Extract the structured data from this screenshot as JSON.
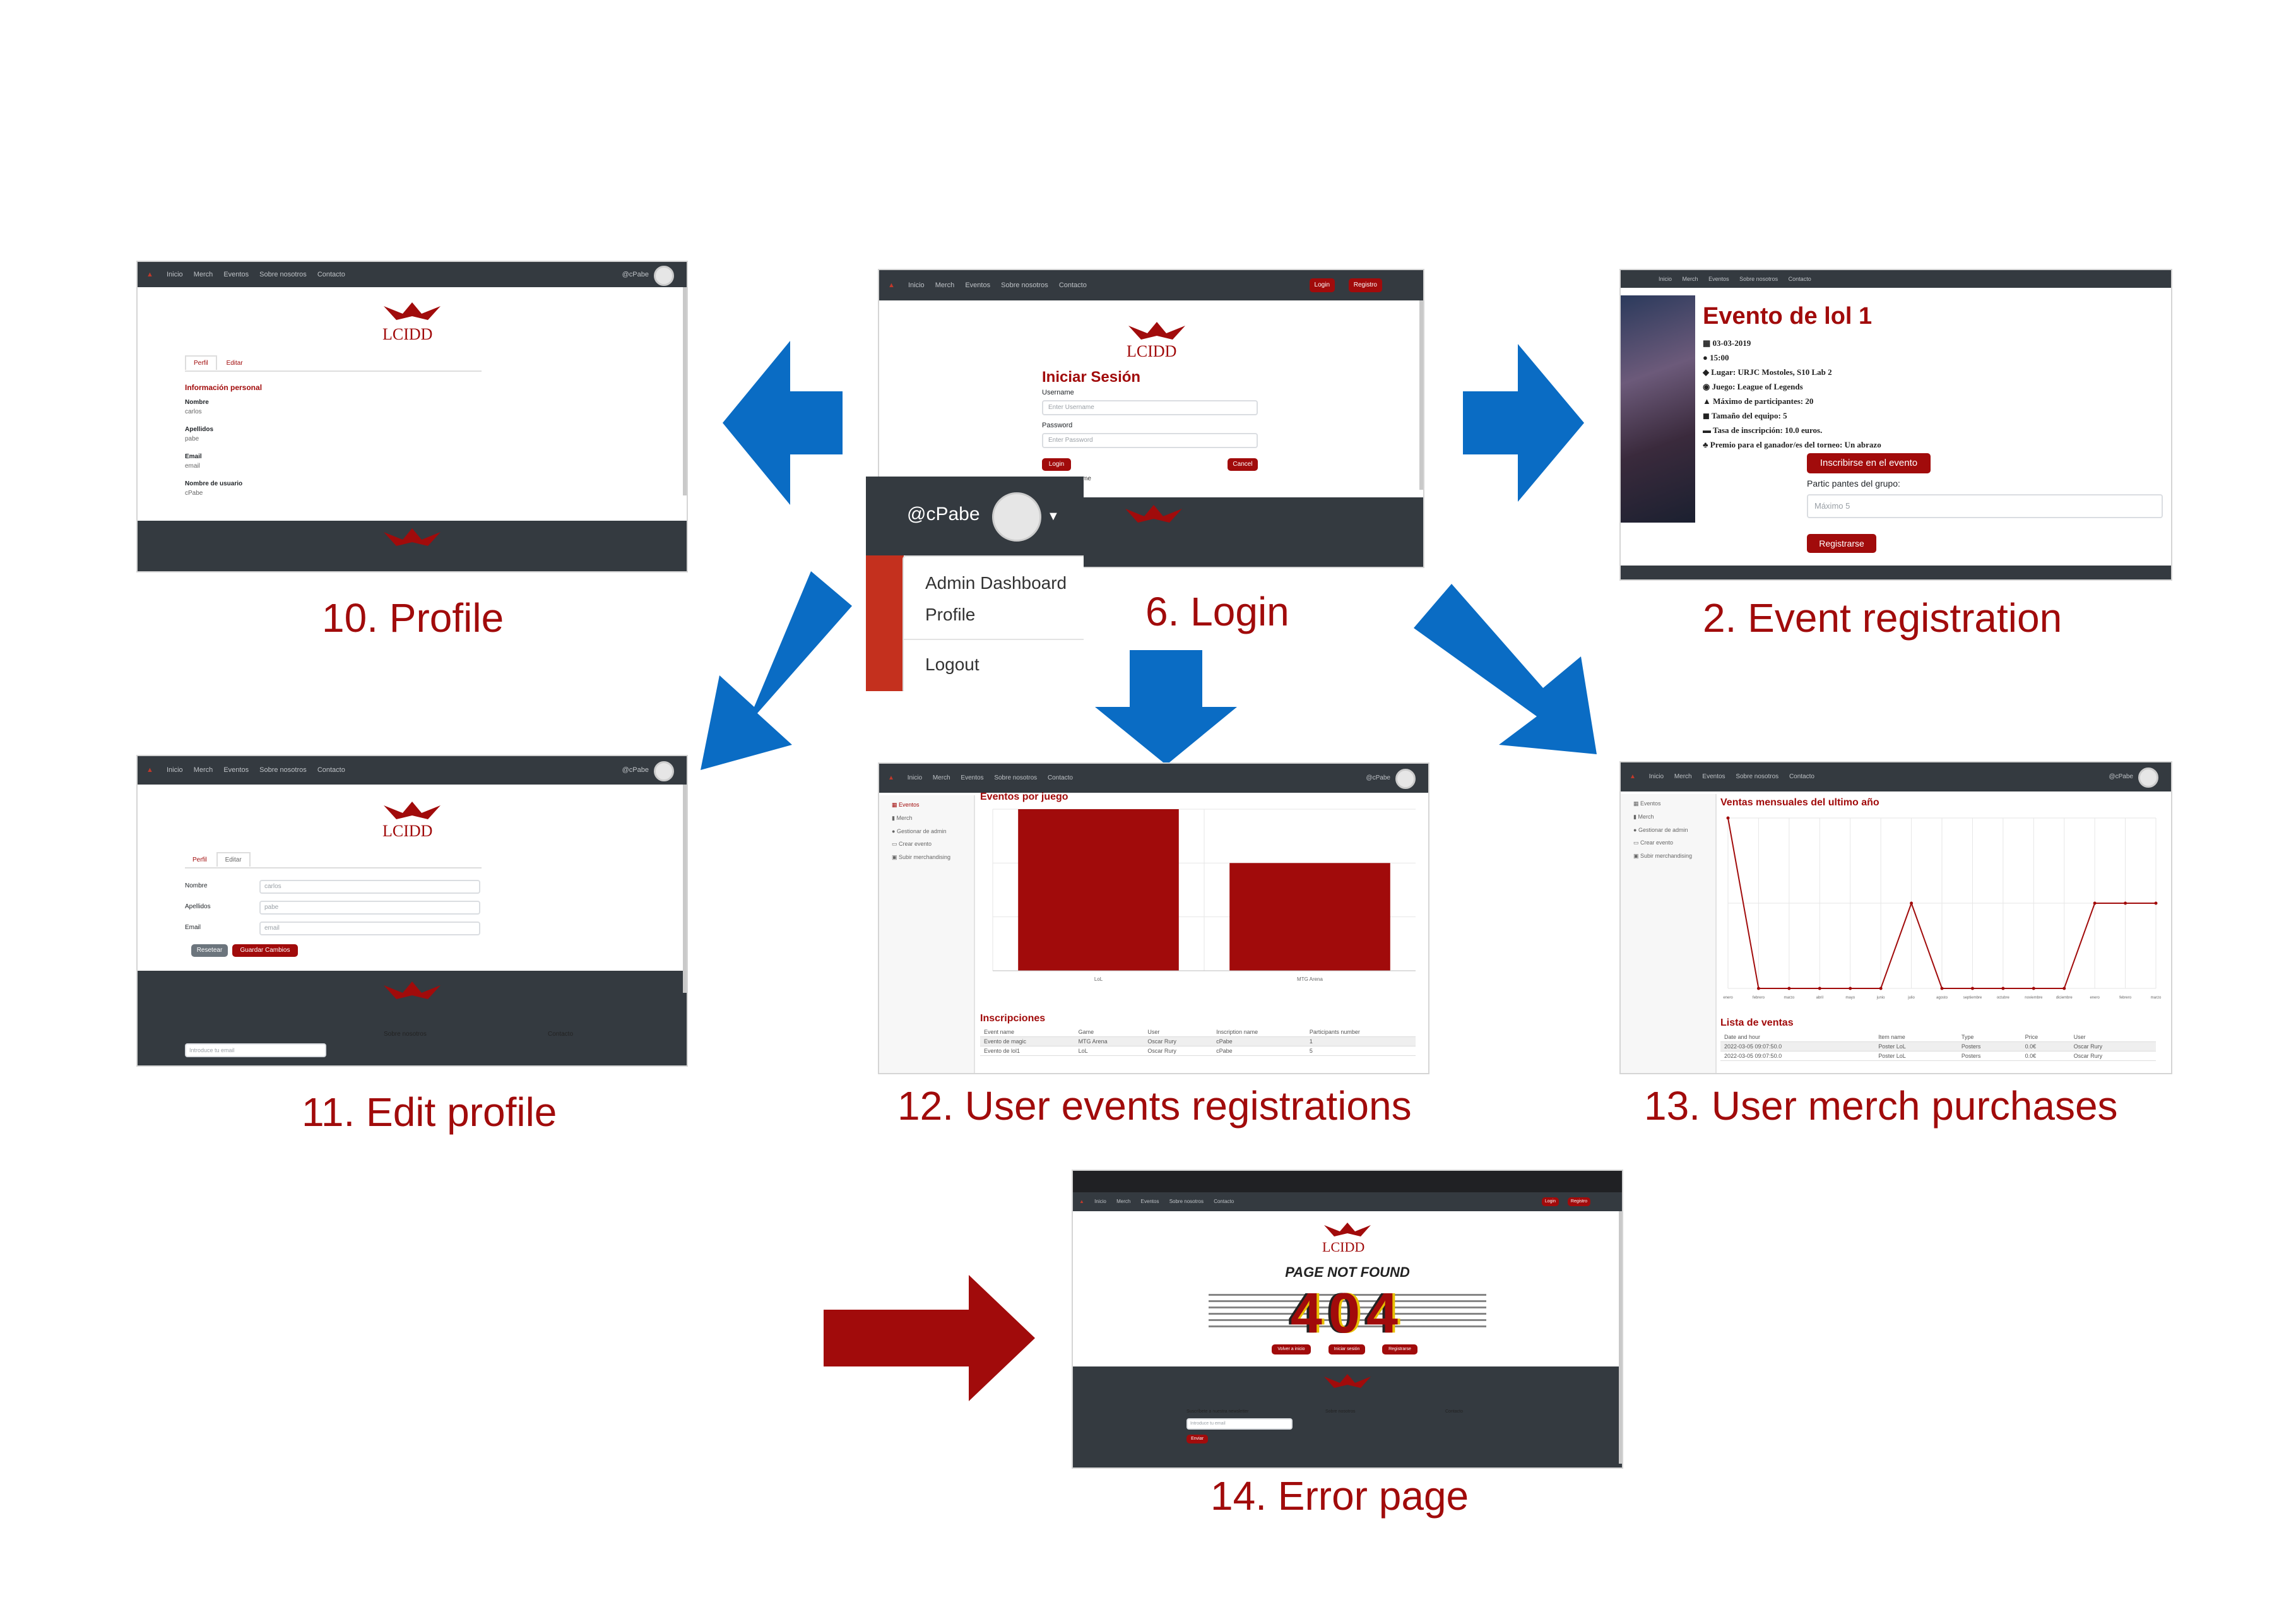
{
  "colors": {
    "accent": "#a10b0b",
    "arrow_blue": "#0a6cc4",
    "nav_dark": "#343a40"
  },
  "nav": {
    "links": [
      "Inicio",
      "Merch",
      "Eventos",
      "Sobre nosotros",
      "Contacto"
    ],
    "user": "@cPabe",
    "login": "Login",
    "registro": "Registro"
  },
  "logo_text": "LCIDD",
  "captions": {
    "profile": "10. Profile",
    "login": "6. Login",
    "event_registration": "2. Event registration",
    "edit_profile": "11. Edit profile",
    "user_events": "12. User events registrations",
    "user_merch": "13. User merch purchases",
    "error": "14. Error page"
  },
  "profile": {
    "tabs": [
      "Perfil",
      "Editar"
    ],
    "heading": "Información personal",
    "fields": [
      {
        "label": "Nombre",
        "value": "carlos"
      },
      {
        "label": "Apellidos",
        "value": "pabe"
      },
      {
        "label": "Email",
        "value": "email"
      },
      {
        "label": "Nombre de usuario",
        "value": "cPabe"
      }
    ]
  },
  "login": {
    "title": "Iniciar Sesión",
    "username_label": "Username",
    "username_placeholder": "Enter Username",
    "password_label": "Password",
    "password_placeholder": "Enter Password",
    "login_button": "Login",
    "cancel_button": "Cancel",
    "remember": "me",
    "dropdown": {
      "user": "@cPabe",
      "items": [
        "Admin Dashboard",
        "Profile",
        "Logout"
      ]
    }
  },
  "event": {
    "title": "Evento de lol 1",
    "details": [
      "03-03-2019",
      "15:00",
      "Lugar: URJC Mostoles, S10 Lab 2",
      "Juego: League of Legends",
      "Máximo de participantes: 20",
      "Tamaño del equipo: 5",
      "Tasa de inscripción: 10.0 euros.",
      "Premio para el ganador/es del torneo: Un abrazo"
    ],
    "enroll_button": "Inscribirse en el evento",
    "group_label": "Partic pantes del grupo:",
    "group_placeholder": "Máximo 5",
    "register_button": "Registrarse"
  },
  "edit_profile": {
    "tabs": [
      "Perfil",
      "Editar"
    ],
    "fields": [
      {
        "label": "Nombre",
        "value": "carlos"
      },
      {
        "label": "Apellidos",
        "value": "pabe"
      },
      {
        "label": "Email",
        "value": "email"
      }
    ],
    "reset_button": "Resetear",
    "save_button": "Guardar Cambios",
    "footer_links": [
      "Sobre nosotros",
      "Contacto"
    ],
    "newsletter_placeholder": "Introduce tu email"
  },
  "dashboard": {
    "sidebar": [
      "Eventos",
      "Merch",
      "Gestionar de admin",
      "Crear evento",
      "Subir merchandising"
    ]
  },
  "user_events": {
    "chart_title": "Eventos por juego",
    "table_title": "Inscripciones",
    "columns": [
      "Event name",
      "Game",
      "User",
      "Inscription name",
      "Participants number"
    ],
    "rows": [
      [
        "Evento de magic",
        "MTG Arena",
        "Oscar Rury",
        "cPabe",
        "1"
      ],
      [
        "Evento de lol1",
        "LoL",
        "Oscar Rury",
        "cPabe",
        "5"
      ]
    ]
  },
  "chart_data": [
    {
      "type": "bar",
      "title": "Eventos por juego",
      "categories": [
        "LoL",
        "MTG Arena"
      ],
      "values": [
        3,
        2
      ],
      "ylim": [
        0,
        3
      ]
    },
    {
      "type": "line",
      "title": "Ventas mensuales del ultimo año",
      "categories": [
        "enero",
        "febrero",
        "marzo",
        "abril",
        "mayo",
        "junio",
        "julio",
        "agosto",
        "septiembre",
        "octubre",
        "noviembre",
        "diciembre",
        "enero",
        "febrero",
        "marzo"
      ],
      "values": [
        2,
        0,
        0,
        0,
        0,
        0,
        1,
        0,
        0,
        0,
        0,
        0,
        1,
        1,
        1
      ],
      "ylim": [
        0,
        2
      ]
    }
  ],
  "user_merch": {
    "chart_title": "Ventas mensuales del ultimo año",
    "table_title": "Lista de ventas",
    "columns": [
      "Date and hour",
      "Item name",
      "Type",
      "Price",
      "User"
    ],
    "rows": [
      [
        "2022-03-05 09:07:50.0",
        "Poster LoL",
        "Posters",
        "0.0€",
        "Oscar Rury"
      ],
      [
        "2022-03-05 09:07:50.0",
        "Poster LoL",
        "Posters",
        "0.0€",
        "Oscar Rury"
      ]
    ]
  },
  "error_page": {
    "title": "PAGE NOT FOUND",
    "code": "404",
    "buttons": [
      "Volver a inicio",
      "Iniciar sesión",
      "Registrarse"
    ],
    "newsletter_label": "Suscríbete a nuestra newsletter",
    "newsletter_placeholder": "Introduce tu email",
    "send_button": "Enviar",
    "footer_links": [
      "Sobre nosotros",
      "Contacto"
    ],
    "login": "Login",
    "registro": "Registro"
  }
}
